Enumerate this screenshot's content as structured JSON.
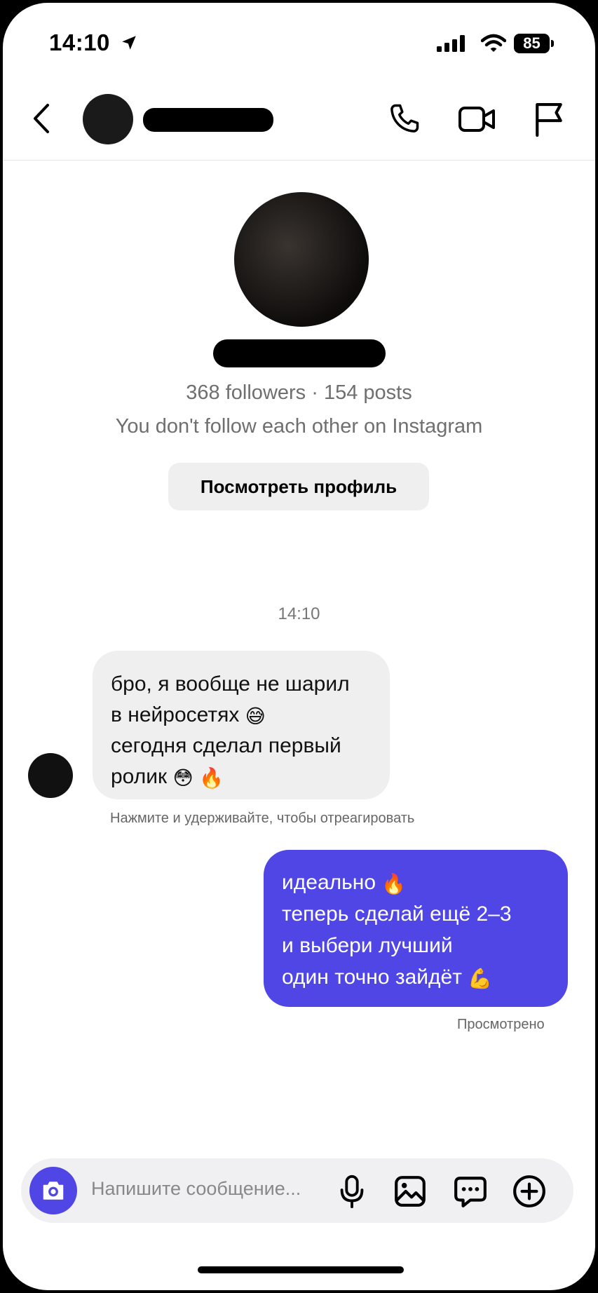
{
  "status_bar": {
    "time": "14:10",
    "battery": "85"
  },
  "header": {
    "contact_name": ""
  },
  "profile": {
    "stats": "368 followers · 154 posts",
    "relation": "You don't follow each other on Instagram",
    "view_profile_label": "Посмотреть профиль"
  },
  "thread": {
    "timestamp": "14:10",
    "messages": [
      {
        "direction": "incoming",
        "lines": [
          "бро, я вообще не шарил",
          "в нейросетях",
          "сегодня сделал первый",
          "ролик"
        ],
        "emojis": [
          "😅",
          "😳",
          "🔥"
        ]
      },
      {
        "direction": "outgoing",
        "lines": [
          "идеально",
          "теперь сделай ещё 2–3",
          "и выбери лучший",
          "один точно зайдёт"
        ],
        "emojis": [
          "🔥",
          "💪"
        ]
      }
    ],
    "react_hint": "Нажмите и удерживайте, чтобы отреагировать",
    "seen_label": "Просмотрено"
  },
  "composer": {
    "placeholder": "Напишите сообщение..."
  },
  "colors": {
    "accent": "#4f46e5",
    "incoming_bubble": "#efefef",
    "composer_bg": "#f0f0f2"
  },
  "icons": [
    "location-arrow-icon",
    "signal-icon",
    "wifi-icon",
    "back-chevron-icon",
    "phone-icon",
    "video-icon",
    "flag-icon",
    "camera-icon",
    "mic-icon",
    "gallery-icon",
    "sticker-icon",
    "plus-icon"
  ]
}
